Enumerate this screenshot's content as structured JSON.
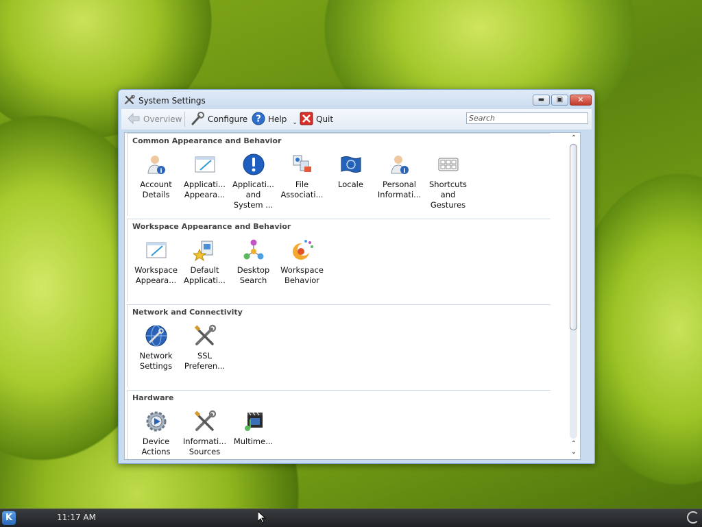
{
  "window": {
    "title": "System Settings",
    "icon": "tools-icon",
    "controls": [
      "minimize-icon",
      "maximize-icon",
      "close-icon"
    ]
  },
  "toolbar": {
    "overview": "Overview",
    "configure": "Configure",
    "help": "Help",
    "quit": "Quit",
    "search_placeholder": "Search"
  },
  "sections": [
    {
      "title": "Common Appearance and Behavior",
      "modules": [
        {
          "label": "Account\nDetails",
          "icon": "account-details-icon"
        },
        {
          "label": "Applicati...\nAppeara...",
          "icon": "application-appearance-icon"
        },
        {
          "label": "Applicati...\nand\nSystem ...",
          "icon": "notifications-icon"
        },
        {
          "label": "File\nAssociati...",
          "icon": "file-associations-icon"
        },
        {
          "label": "Locale",
          "icon": "locale-flag-icon"
        },
        {
          "label": "Personal\nInformati...",
          "icon": "personal-information-icon"
        },
        {
          "label": "Shortcuts\nand\nGestures",
          "icon": "keyboard-shortcuts-icon"
        }
      ]
    },
    {
      "title": "Workspace Appearance and Behavior",
      "modules": [
        {
          "label": "Workspace\nAppeara...",
          "icon": "workspace-appearance-icon"
        },
        {
          "label": "Default\nApplicati...",
          "icon": "default-applications-icon"
        },
        {
          "label": "Desktop\nSearch",
          "icon": "desktop-search-icon"
        },
        {
          "label": "Workspace\nBehavior",
          "icon": "workspace-behavior-icon"
        }
      ]
    },
    {
      "title": "Network and Connectivity",
      "modules": [
        {
          "label": "Network\nSettings",
          "icon": "network-globe-icon"
        },
        {
          "label": "SSL\nPreferen...",
          "icon": "ssl-tools-icon"
        }
      ]
    },
    {
      "title": "Hardware",
      "modules": [
        {
          "label": "Device\nActions",
          "icon": "device-actions-icon"
        },
        {
          "label": "Informati...\nSources",
          "icon": "information-sources-icon"
        },
        {
          "label": "Multime...",
          "icon": "multimedia-icon"
        }
      ]
    }
  ],
  "scrollbar": {
    "position": 0.0
  },
  "taskbar": {
    "clock": "11:17 AM",
    "start_icon": "kde-menu-icon",
    "tray_icon": "power-icon"
  },
  "colors": {
    "title_bg": "#c9dbef",
    "close_btn": "#c1392a",
    "taskbar": "#2a2c2f"
  }
}
